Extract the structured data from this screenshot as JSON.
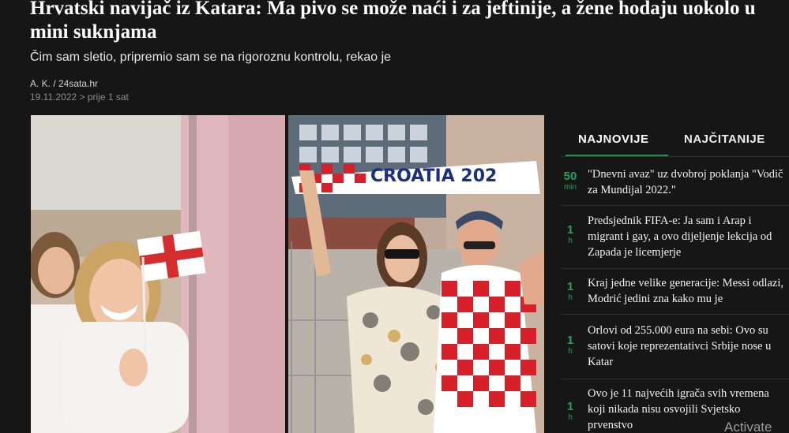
{
  "article": {
    "title": "Hrvatski navijač iz Katara: Ma pivo se može naći i za jeftinije, a žene hodaju uokolo u mini suknjama",
    "lead": "Čim sam sletio, pripremio sam se na rigoroznu kontrolu, rekao je",
    "author": "A. K. / 24sata.hr",
    "date": "19.11.2022 > prije 1 sat"
  },
  "image": {
    "flag_text": "CROATIA 202"
  },
  "sidebar": {
    "tabs": [
      "NAJNOVIJE",
      "NAJČITANIJE"
    ],
    "items": [
      {
        "age": "50",
        "unit": "min",
        "title": "\"Dnevni avaz\" uz dvobroj poklanja \"Vodič za Mundijal 2022.\""
      },
      {
        "age": "1",
        "unit": "h",
        "title": "Predsjednik FIFA-e: Ja sam i Arap i migrant i gay, a ovo dijeljenje lekcija od Zapada je licemjerje"
      },
      {
        "age": "1",
        "unit": "h",
        "title": "Kraj jedne velike generacije: Messi odlazi, Modrić jedini zna kako mu je"
      },
      {
        "age": "1",
        "unit": "h",
        "title": "Orlovi od 255.000 eura na sebi: Ovo su satovi koje reprezentativci Srbije nose u Katar"
      },
      {
        "age": "1",
        "unit": "h",
        "title": "Ovo je 11 najvećih igrača svih vremena koji nikada nisu osvojili Svjetsko prvenstvo"
      }
    ]
  },
  "overlay": {
    "activate": "Activate"
  },
  "colors": {
    "background": "#161616",
    "accent": "#23a45d"
  }
}
